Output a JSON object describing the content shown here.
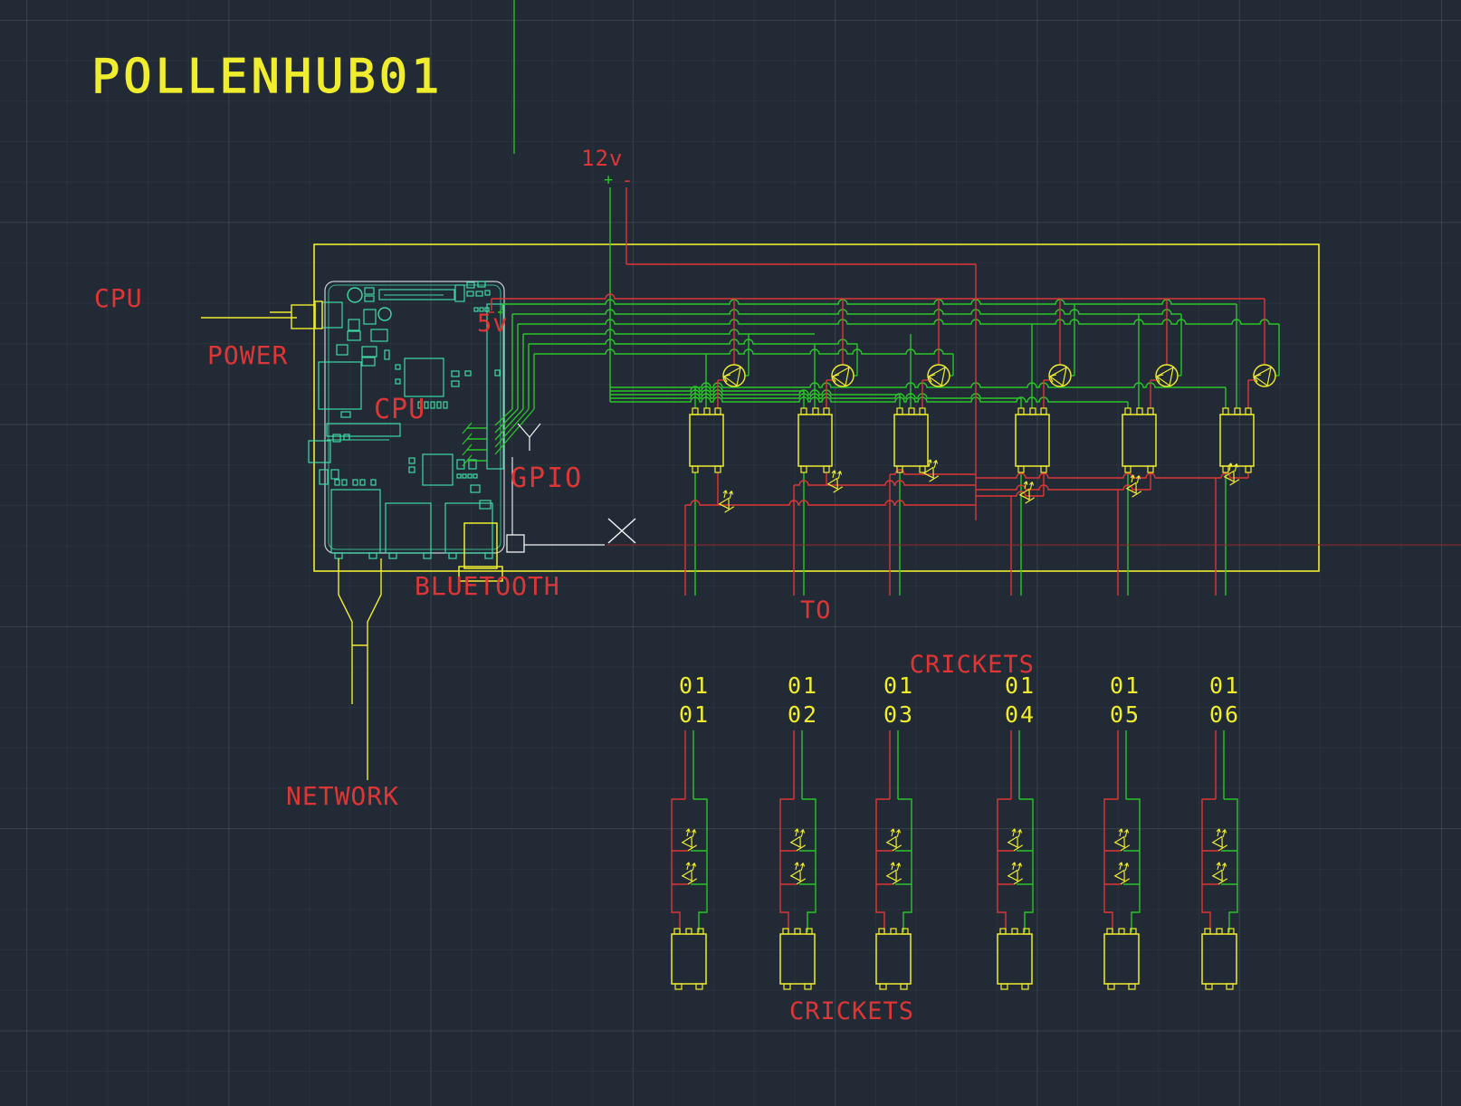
{
  "title": "POLLENHUB01",
  "colors": {
    "background": "#222A35",
    "grid": "#2A3341",
    "yellow": "#F0ED2F",
    "red": "#DE3636",
    "dim_red": "#8E2727",
    "green": "#2BC52B",
    "teal": "#3FD9A4",
    "board_outline": "#C9CFD8",
    "white": "#F2F4F6"
  },
  "labels": {
    "cpu_power_line1": "CPU",
    "cpu_power_line2": "POWER",
    "cpu": "CPU",
    "five_v": "5v",
    "twelve_v": "12v",
    "twelve_v_plus": "+",
    "twelve_v_minus": "-",
    "gpio": "GPIO",
    "bluetooth": "BLUETOOTH",
    "network": "NETWORK",
    "to_crickets_line1": "TO",
    "to_crickets_line2": "CRICKETS",
    "crickets_footer": "CRICKETS"
  },
  "cricket_ports": [
    {
      "line1": "01",
      "line2": "01"
    },
    {
      "line1": "01",
      "line2": "02"
    },
    {
      "line1": "01",
      "line2": "03"
    },
    {
      "line1": "01",
      "line2": "04"
    },
    {
      "line1": "01",
      "line2": "05"
    },
    {
      "line1": "01",
      "line2": "06"
    }
  ]
}
